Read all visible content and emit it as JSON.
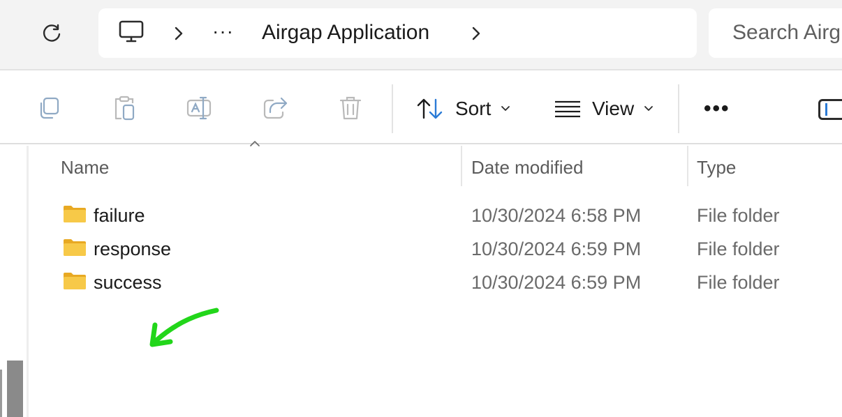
{
  "address_bar": {
    "ellipsis": "···",
    "current_folder": "Airgap Application",
    "pc_icon": "computer-icon",
    "chevron_icon": "chevron-right-icon"
  },
  "search": {
    "text": "Search Airg"
  },
  "toolbar": {
    "copy_icon": "copy-icon",
    "paste_icon": "paste-icon",
    "rename_icon": "rename-icon",
    "share_icon": "share-icon",
    "delete_icon": "trash-icon",
    "sort_label": "Sort",
    "view_label": "View",
    "more_label": "•••"
  },
  "columns": {
    "name": "Name",
    "date": "Date modified",
    "type": "Type"
  },
  "files": [
    {
      "name": "failure",
      "date": "10/30/2024 6:58 PM",
      "type": "File folder"
    },
    {
      "name": "response",
      "date": "10/30/2024 6:59 PM",
      "type": "File folder"
    },
    {
      "name": "success",
      "date": "10/30/2024 6:59 PM",
      "type": "File folder"
    }
  ],
  "colors": {
    "accent": "#2b7bd6",
    "folder": "#f7c948",
    "annotation_arrow": "#22d61a",
    "disabled_icon": "#8fa9c4"
  }
}
